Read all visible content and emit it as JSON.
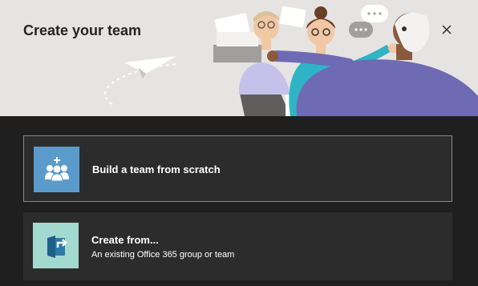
{
  "dialog": {
    "title": "Create your team",
    "close_icon": "close-icon"
  },
  "options": [
    {
      "title": "Build a team from scratch",
      "subtitle": "",
      "icon": "people-add-icon",
      "icon_bg": "#5b9bcc"
    },
    {
      "title": "Create from...",
      "subtitle": "An existing Office 365 group or team",
      "icon": "group-convert-icon",
      "icon_bg": "#a3dad0"
    }
  ]
}
